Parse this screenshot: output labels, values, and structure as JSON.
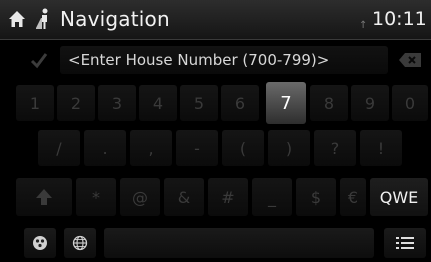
{
  "header": {
    "title": "Navigation",
    "clock": "10:11",
    "signal_indicator": "↑"
  },
  "entry": {
    "prompt_text": "<Enter House Number (700-799)>"
  },
  "keyboard": {
    "row1": [
      "1",
      "2",
      "3",
      "4",
      "5",
      "6",
      "7",
      "8",
      "9",
      "0"
    ],
    "row1_active_key": "7",
    "row2": [
      "/",
      ".",
      ",",
      "-",
      "(",
      ")",
      "?",
      "!"
    ],
    "row3": [
      "*",
      "@",
      "&",
      "#",
      "_",
      "$",
      "€"
    ],
    "mode_key_label": "QWE"
  },
  "icons": {
    "home": "home-icon",
    "navigation": "navigation-person-icon",
    "confirm": "checkmark-icon",
    "backspace": "backspace-icon",
    "shift": "shift-arrow-icon",
    "symbols": "symbols-icon",
    "language": "globe-icon",
    "list": "list-icon"
  },
  "colors": {
    "background": "#000000",
    "active_key": "#5a5a5a",
    "text": "#e6e6e6",
    "dim_key_text": "#3a3a3a"
  }
}
